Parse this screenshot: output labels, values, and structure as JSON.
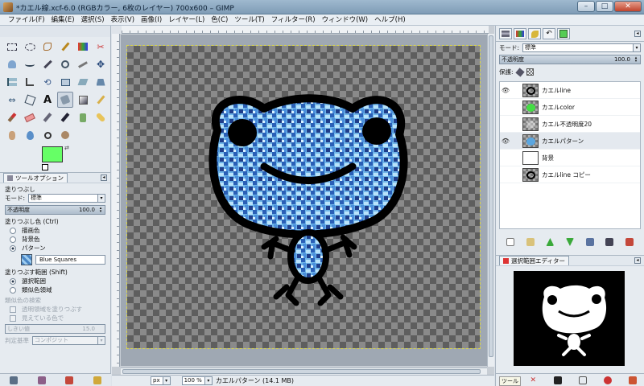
{
  "window": {
    "title": "*カエル線.xcf-6.0 (RGBカラー, 6枚のレイヤー) 700x600 – GIMP",
    "minimize": "–",
    "maximize": "□",
    "close": "✕"
  },
  "menu": [
    "ファイル(F)",
    "編集(E)",
    "選択(S)",
    "表示(V)",
    "画像(I)",
    "レイヤー(L)",
    "色(C)",
    "ツール(T)",
    "フィルター(R)",
    "ウィンドウ(W)",
    "ヘルプ(H)"
  ],
  "toolbox": {
    "fg_color": "#66ff66",
    "bg_color": "#ffffff",
    "tool_options_tab": "ツールオプション",
    "tool_name": "塗りつぶし",
    "mode_label": "モード:",
    "mode_value": "標準",
    "opacity_label": "不透明度",
    "opacity_value": "100.0",
    "fill_type_label": "塗りつぶし色 (Ctrl)",
    "fill_fg": "描画色",
    "fill_bg": "背景色",
    "fill_pattern": "パターン",
    "pattern_name": "Blue Squares",
    "fill_area_label": "塗りつぶす範囲 (Shift)",
    "area_selection": "選択範囲",
    "area_similar": "類似色領域",
    "similar_header": "類似色の検索",
    "fill_transparent": "透明領域を塗りつぶす",
    "sample_merged": "見えている色で",
    "threshold_label": "しきい値",
    "threshold_value": "15.0",
    "criterion_label": "判定基準",
    "criterion_value": "コンポジット"
  },
  "canvas": {
    "unit": "px",
    "zoom": "100 %",
    "status": "カエルパターン (14.1 MB)"
  },
  "dock": {
    "mode_label": "モード:",
    "mode_value": "標準",
    "opacity_label": "不透明度",
    "opacity_value": "100.0",
    "lock_label": "保護:",
    "layers": [
      {
        "name": "カエルline",
        "visible": true
      },
      {
        "name": "カエルcolor",
        "visible": false
      },
      {
        "name": "カエル不透明度20",
        "visible": false
      },
      {
        "name": "カエルパターン",
        "visible": true
      },
      {
        "name": "背景",
        "visible": false
      },
      {
        "name": "カエルline コピー",
        "visible": false
      }
    ],
    "selection_editor_tab": "選択範囲エディター",
    "tooltip": "ツール"
  }
}
